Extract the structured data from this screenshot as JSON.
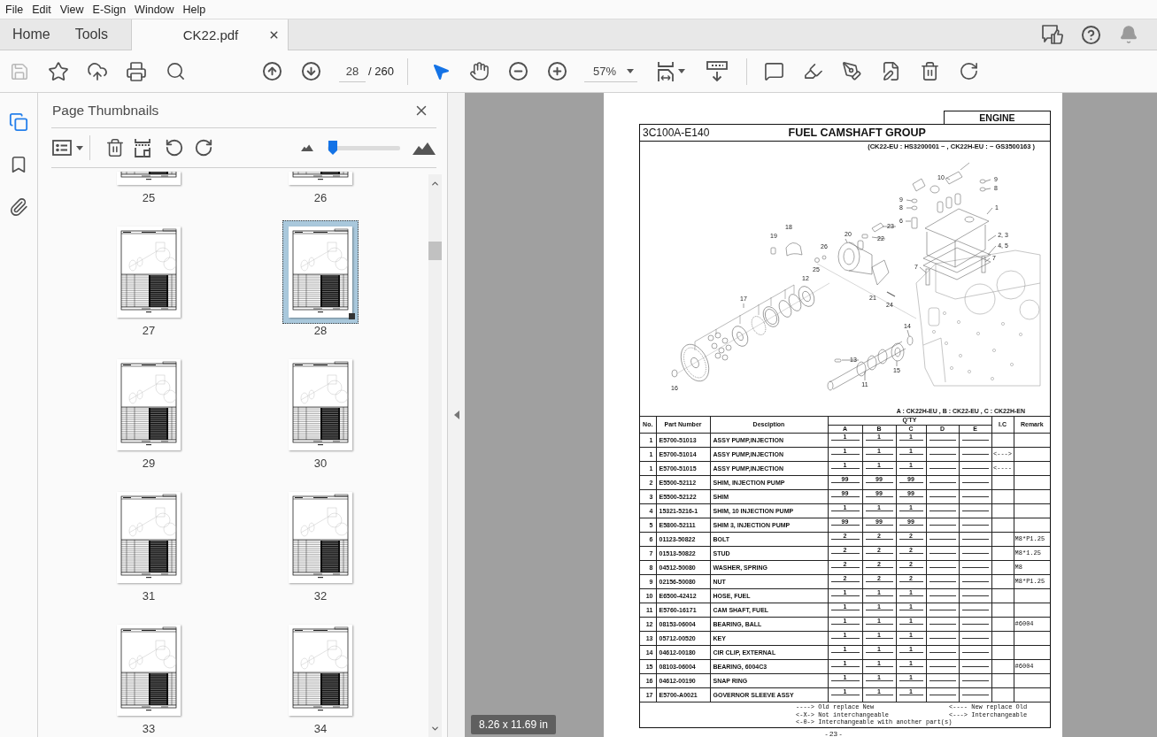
{
  "menu": [
    "File",
    "Edit",
    "View",
    "E-Sign",
    "Window",
    "Help"
  ],
  "tabs": [
    {
      "label": "Home",
      "kind": "nav",
      "selected": false
    },
    {
      "label": "Tools",
      "kind": "nav",
      "selected": false
    },
    {
      "label": "CK22.pdf",
      "kind": "document",
      "selected": true
    }
  ],
  "toolbar": {
    "save": {
      "disabled": true
    },
    "page": "28",
    "page_total": "/ 260",
    "pointer_tools": [
      {
        "kind": "select",
        "selected": true
      },
      {
        "kind": "hand",
        "selected": false
      }
    ],
    "zoom": "57%"
  },
  "side_rail": [
    {
      "kind": "pages",
      "selected": true
    },
    {
      "kind": "bookmarks",
      "selected": false
    },
    {
      "kind": "attachments",
      "selected": false
    }
  ],
  "sidebar": {
    "title": "Page Thumbnails",
    "thumbnail_size": {
      "level": 0.07
    },
    "thumbnails": [
      {
        "label": "25",
        "selected": false
      },
      {
        "label": "26",
        "selected": false
      },
      {
        "label": "27",
        "selected": false
      },
      {
        "label": "28",
        "selected": true
      },
      {
        "label": "29",
        "selected": false
      },
      {
        "label": "30",
        "selected": false
      },
      {
        "label": "31",
        "selected": false
      },
      {
        "label": "32",
        "selected": false
      },
      {
        "label": "33",
        "selected": false
      },
      {
        "label": "34",
        "selected": false
      }
    ]
  },
  "document": {
    "section": "ENGINE",
    "code": "3C100A-E140",
    "title": "FUEL CAMSHAFT GROUP",
    "applicability": "(CK22-EU : HS3200001 ~ , CK22H-EU : ~ GS3500163 )",
    "callouts": [
      "10",
      "9",
      "8",
      "9",
      "8",
      "1",
      "6",
      "23",
      "18",
      "20",
      "19",
      "2, 3",
      "22",
      "4, 5",
      "26",
      "7",
      "7",
      "25",
      "12",
      "21",
      "17",
      "24",
      "14",
      "13",
      "15",
      "11",
      "16"
    ],
    "model_key": "A : CK22H-EU , B : CK22-EU , C : CK22H-EN",
    "table": {
      "columns": {
        "no": "No.",
        "part_number": "Part Number",
        "description": "Desciption",
        "qty": "Q'TY",
        "ic": "I.C",
        "remark": "Remark"
      },
      "qty_columns": [
        "A",
        "B",
        "C",
        "D",
        "E"
      ],
      "rows": [
        {
          "no": "1",
          "part_number": "E5700-51013",
          "description": "ASSY PUMP,INJECTION",
          "qty": [
            "1",
            "1",
            "1"
          ]
        },
        {
          "no": "1",
          "part_number": "E5700-51014",
          "description": "ASSY PUMP,INJECTION",
          "qty": [
            "1",
            "1",
            "1"
          ],
          "ic": "<--->"
        },
        {
          "no": "1",
          "part_number": "E5700-51015",
          "description": "ASSY PUMP,INJECTION",
          "qty": [
            "1",
            "1",
            "1"
          ],
          "ic": "<----"
        },
        {
          "no": "2",
          "part_number": "E5500-52112",
          "description": "SHIM, INJECTION PUMP",
          "qty": [
            "99",
            "99",
            "99"
          ]
        },
        {
          "no": "3",
          "part_number": "E5500-52122",
          "description": "SHIM",
          "qty": [
            "99",
            "99",
            "99"
          ]
        },
        {
          "no": "4",
          "part_number": "15321-5216-1",
          "description": "SHIM, 10 INJECTION PUMP",
          "qty": [
            "1",
            "1",
            "1"
          ]
        },
        {
          "no": "5",
          "part_number": "E5800-52111",
          "description": "SHIM 3, INJECTION PUMP",
          "qty": [
            "99",
            "99",
            "99"
          ]
        },
        {
          "no": "6",
          "part_number": "01123-50822",
          "description": "BOLT",
          "qty": [
            "2",
            "2",
            "2"
          ],
          "remark": "M8*P1.25"
        },
        {
          "no": "7",
          "part_number": "01513-50822",
          "description": "STUD",
          "qty": [
            "2",
            "2",
            "2"
          ],
          "remark": "M8*1.25"
        },
        {
          "no": "8",
          "part_number": "04512-50080",
          "description": "WASHER, SPRING",
          "qty": [
            "2",
            "2",
            "2"
          ],
          "remark": "M8"
        },
        {
          "no": "9",
          "part_number": "02156-50080",
          "description": "NUT",
          "qty": [
            "2",
            "2",
            "2"
          ],
          "remark": "M8*P1.25"
        },
        {
          "no": "10",
          "part_number": "E6500-42412",
          "description": "HOSE, FUEL",
          "qty": [
            "1",
            "1",
            "1"
          ]
        },
        {
          "no": "11",
          "part_number": "E5760-16171",
          "description": "CAM SHAFT, FUEL",
          "qty": [
            "1",
            "1",
            "1"
          ]
        },
        {
          "no": "12",
          "part_number": "08153-06004",
          "description": "BEARING, BALL",
          "qty": [
            "1",
            "1",
            "1"
          ],
          "remark": "#6004"
        },
        {
          "no": "13",
          "part_number": "05712-00520",
          "description": "KEY",
          "qty": [
            "1",
            "1",
            "1"
          ]
        },
        {
          "no": "14",
          "part_number": "04612-00180",
          "description": "CIR CLIP, EXTERNAL",
          "qty": [
            "1",
            "1",
            "1"
          ]
        },
        {
          "no": "15",
          "part_number": "08103-06004",
          "description": "BEARING, 6004C3",
          "qty": [
            "1",
            "1",
            "1"
          ],
          "remark": "#6004"
        },
        {
          "no": "16",
          "part_number": "04612-00190",
          "description": "SNAP RING",
          "qty": [
            "1",
            "1",
            "1"
          ]
        },
        {
          "no": "17",
          "part_number": "E5700-A0021",
          "description": "GOVERNOR SLEEVE ASSY",
          "qty": [
            "1",
            "1",
            "1"
          ]
        }
      ]
    },
    "legend": [
      "----> Old replace New",
      "<---- New replace Old",
      "<-X-> Not interchangeable",
      "<---> Interchangeable",
      "<-0-> Interchangeable with another part(s)"
    ],
    "page_number": "- 23 -"
  },
  "page_size": "8.26 x 11.69 in"
}
